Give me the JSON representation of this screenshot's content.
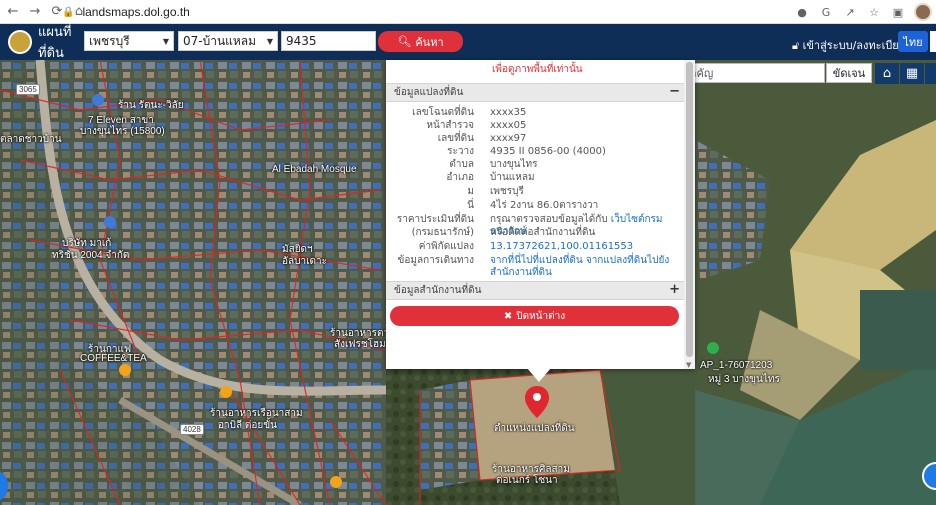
{
  "browser": {
    "url": "landsmaps.dol.go.th"
  },
  "header": {
    "app_title": "แผนที่ที่ดิน",
    "province": "เพชรบุรี",
    "district": "07-บ้านแหลม",
    "parcel_no": "9435",
    "search_label": "ค้นหา",
    "login_label": "เข้าสู่ระบบ/ลงทะเบียน",
    "lang": "ไทย"
  },
  "map_tools": {
    "place_search_placeholder": "ค้นหาสถานที่สำคัญ",
    "detect_label": "ขัดเจน"
  },
  "popup": {
    "top_note": "เพื่อดูภาพพื้นที่เท่านั้น",
    "section_parcel": "ข้อมูลแปลงที่ดิน",
    "section_toggle_open": "−",
    "rows": [
      {
        "label": "เลขโฉนดที่ดิน",
        "value": "xxxx35"
      },
      {
        "label": "หน้าสำรวจ",
        "value": "xxxx05"
      },
      {
        "label": "เลขที่ดิน",
        "value": "xxxx97"
      },
      {
        "label": "ระวาง",
        "value": "4935 II 0856-00 (4000)"
      },
      {
        "label": "ตำบล",
        "value": "บางขุนไทร"
      },
      {
        "label": "อำเภอ",
        "value": "บ้านแหลม"
      },
      {
        "label": "ม",
        "value": "เพชรบุรี"
      },
      {
        "label": "นี่",
        "value": "4ไร่ 2งาน 86.0ตารางวา"
      }
    ],
    "price_label": "ราคาประเมินที่ดิน",
    "price_value": "กรุณาตรวจสอบข้อมูลได้กับ ",
    "price_link": "เว็บไซต์กรมธนารักษ์",
    "price_label2": "(กรมธนารักษ์)",
    "price_value2": "หรือติดต่อสำนักงานที่ดิน",
    "coord_label": "ค่าพิกัดแปลง",
    "coord_value": "13.17372621,100.01161553",
    "travel_label": "ข้อมูลการเดินทาง",
    "travel_value": "จากที่นี่ไปที่แปลงที่ดิน จากแปลงที่ดินไปยังสำนักงานที่ดิน",
    "section_office": "ข้อมูลสำนักงานที่ดิน",
    "section_toggle_closed": "+",
    "close_label": "ปิดหน้าต่าง"
  },
  "map_labels": {
    "road_3065": "3065",
    "road_4028": "4028",
    "seven_eleven": "7 Eleven สาขา",
    "seven_sub": "บางขุนไทร (15800)",
    "shop_top": "ร้าน รัตนะ-วิลัย",
    "market": "ตลาดชาวบ้าน",
    "mosque": "Al Ebadah Mosque",
    "company": "บริษัท มาเก้",
    "company_sub": "ทริชัน 2004 จำกัด",
    "mosque2": "มัสยิดฯ",
    "mosque2_sub": "อัลบาเดาะ",
    "cafe": "ร้านกาแฟ",
    "cafe_sub": "COFFEE&TEA",
    "shop_right": "ร้านอาหารตาม",
    "shop_right_sub": "สั่งเฟรชโฮม",
    "food_shop": "ร้านอาหารเรือนาสาม",
    "food_shop_sub": "อาบิลี ต่อยขั้น",
    "parcel_label": "ตำแหน่งแปลงที่ดิน",
    "food_shop2": "ร้านอาหารศิลสาม",
    "food_shop2_sub": "ต่อเนกร์ โซนา",
    "ap_label": "AP_1-76071203",
    "ap_sub": "หมู่ 3 บางขุนไทร"
  }
}
